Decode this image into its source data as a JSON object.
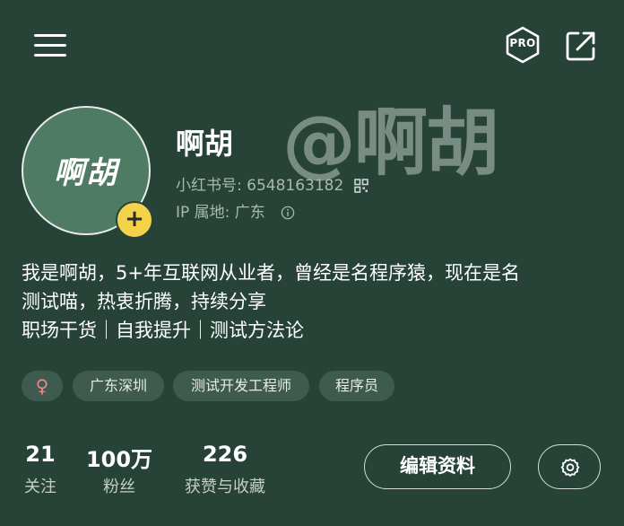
{
  "header": {
    "pro_label": "PRO"
  },
  "watermark": "@啊胡",
  "profile": {
    "avatar_text": "啊胡",
    "name": "啊胡",
    "redid_label": "小红书号: 6548163182",
    "ip_label": "IP 属地: 广东"
  },
  "bio": {
    "line1": "我是啊胡，5+年互联网从业者，曾经是名程序猿，现在是名",
    "line2": "测试喵，热衷折腾，持续分享",
    "line3": "职场干货｜自我提升｜测试方法论"
  },
  "tags": {
    "gender": "♀",
    "location": "广东深圳",
    "job": "测试开发工程师",
    "role": "程序员"
  },
  "stats": {
    "following_count": "21",
    "following_label": "关注",
    "followers_count": "100万",
    "followers_label": "粉丝",
    "likes_count": "226",
    "likes_label": "获赞与收藏"
  },
  "actions": {
    "edit_label": "编辑资料"
  },
  "colors": {
    "background": "#274338",
    "avatar_bg": "#4f7a64",
    "add_badge": "#f4d34a",
    "tag_bg": "#3f5a4f"
  },
  "icons": {
    "menu": "menu-icon",
    "pro": "pro-badge-icon",
    "share": "share-icon",
    "qr": "qr-code-icon",
    "info": "info-icon",
    "settings": "settings-icon",
    "add": "plus-icon"
  }
}
